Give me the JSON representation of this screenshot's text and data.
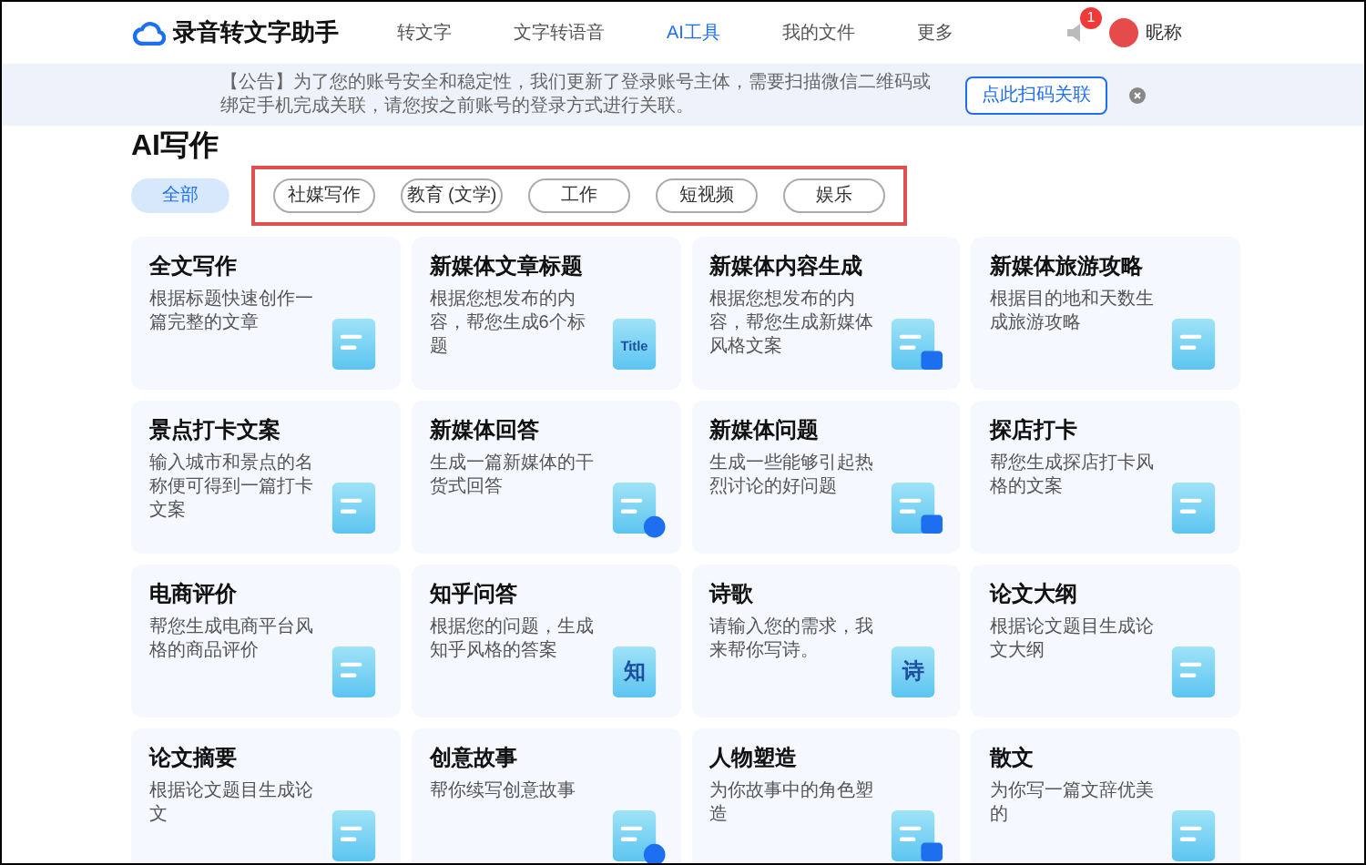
{
  "header": {
    "app_name": "录音转文字助手",
    "nav": [
      {
        "label": "转文字",
        "selected": false
      },
      {
        "label": "文字转语音",
        "selected": false
      },
      {
        "label": "AI工具",
        "selected": true
      },
      {
        "label": "我的文件",
        "selected": false
      },
      {
        "label": "更多",
        "selected": false
      }
    ],
    "notification_count": "1",
    "user_name": "昵称"
  },
  "notice": {
    "text": "【公告】为了您的账号安全和稳定性，我们更新了登录账号主体，需要扫描微信二维码或绑定手机完成关联，请您按之前账号的登录方式进行关联。",
    "button": "点此扫码关联"
  },
  "page_title": "AI写作",
  "filters": [
    {
      "label": "全部",
      "selected": true,
      "highlighted": false
    },
    {
      "label": "社媒写作",
      "selected": false,
      "highlighted": true
    },
    {
      "label": "教育 (文学)",
      "selected": false,
      "highlighted": true
    },
    {
      "label": "工作",
      "selected": false,
      "highlighted": true
    },
    {
      "label": "短视频",
      "selected": false,
      "highlighted": true
    },
    {
      "label": "娱乐",
      "selected": false,
      "highlighted": true
    }
  ],
  "cards": [
    {
      "title": "全文写作",
      "description": "根据标题快速创作一篇完整的文章"
    },
    {
      "title": "新媒体文章标题",
      "description": "根据您想发布的内容，帮您生成6个标题",
      "icon_label": "Title"
    },
    {
      "title": "新媒体内容生成",
      "description": "根据您想发布的内容，帮您生成新媒体风格文案"
    },
    {
      "title": "新媒体旅游攻略",
      "description": "根据目的地和天数生成旅游攻略"
    },
    {
      "title": "景点打卡文案",
      "description": "输入城市和景点的名称便可得到一篇打卡文案"
    },
    {
      "title": "新媒体回答",
      "description": "生成一篇新媒体的干货式回答"
    },
    {
      "title": "新媒体问题",
      "description": "生成一些能够引起热烈讨论的好问题"
    },
    {
      "title": "探店打卡",
      "description": "帮您生成探店打卡风格的文案"
    },
    {
      "title": "电商评价",
      "description": "帮您生成电商平台风格的商品评价"
    },
    {
      "title": "知乎问答",
      "description": "根据您的问题，生成知乎风格的答案",
      "icon_label": "知"
    },
    {
      "title": "诗歌",
      "description": "请输入您的需求，我来帮你写诗。",
      "icon_label": "诗"
    },
    {
      "title": "论文大纲",
      "description": "根据论文题目生成论文大纲"
    },
    {
      "title": "论文摘要",
      "description": "根据论文题目生成论文"
    },
    {
      "title": "创意故事",
      "description": "帮你续写创意故事"
    },
    {
      "title": "人物塑造",
      "description": "为你故事中的角色塑造"
    },
    {
      "title": "散文",
      "description": "为你写一篇文辞优美的"
    }
  ]
}
